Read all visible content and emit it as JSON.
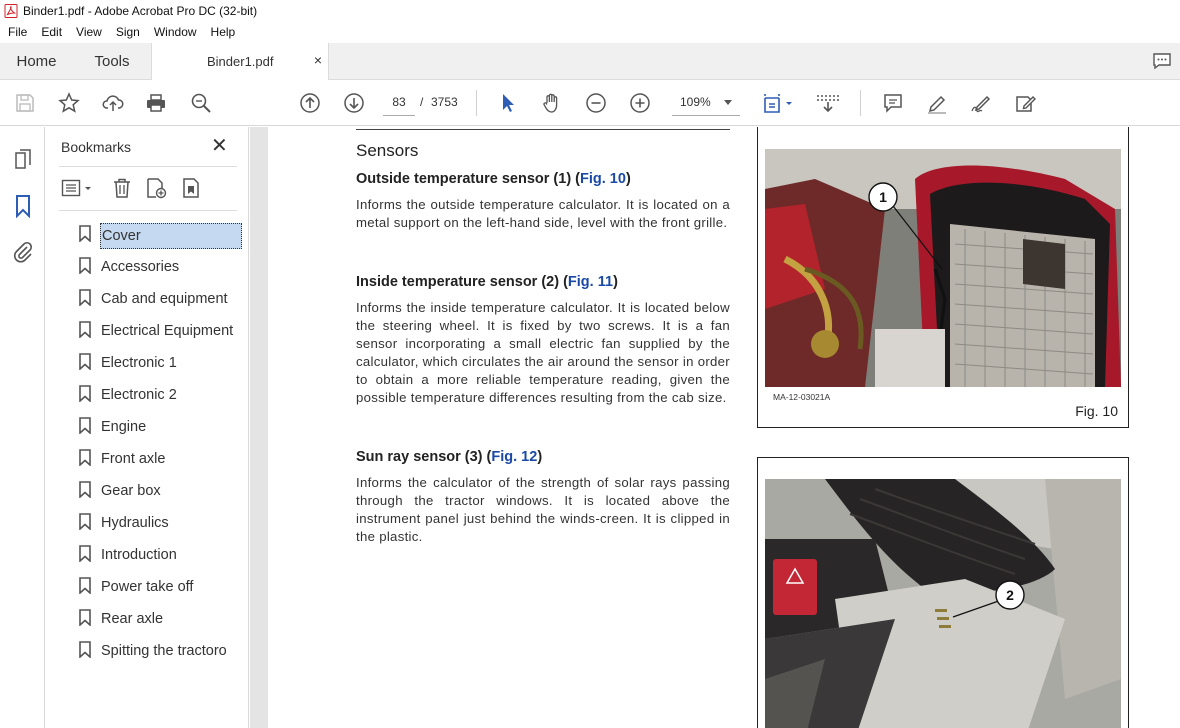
{
  "window": {
    "title": "Binder1.pdf - Adobe Acrobat Pro DC (32-bit)"
  },
  "menu": [
    "File",
    "Edit",
    "View",
    "Sign",
    "Window",
    "Help"
  ],
  "tabs": {
    "home": "Home",
    "tools": "Tools",
    "document": "Binder1.pdf",
    "close_glyph": "×"
  },
  "toolbar": {
    "current_page": "83",
    "page_separator": "/",
    "total_pages": "3753",
    "zoom": "109%"
  },
  "bookmarks": {
    "title": "Bookmarks",
    "close_glyph": "✕",
    "items": [
      {
        "label": "Cover",
        "selected": true
      },
      {
        "label": "Accessories"
      },
      {
        "label": "Cab and equipment"
      },
      {
        "label": "Electrical Equipment"
      },
      {
        "label": "Electronic 1"
      },
      {
        "label": "Electronic 2"
      },
      {
        "label": "Engine"
      },
      {
        "label": "Front axle"
      },
      {
        "label": "Gear box"
      },
      {
        "label": "Hydraulics"
      },
      {
        "label": "Introduction"
      },
      {
        "label": "Power take off"
      },
      {
        "label": "Rear axle"
      },
      {
        "label": "Spitting the tractoro"
      }
    ]
  },
  "document": {
    "section_title": "Sensors",
    "sections": [
      {
        "heading_prefix": "Outside temperature sensor (1) (",
        "fig_ref": "Fig. 10",
        "heading_suffix": ")",
        "body": "Informs the outside temperature calculator. It is located on a metal support on the left-hand side, level with the front grille."
      },
      {
        "heading_prefix": "Inside temperature sensor (2) (",
        "fig_ref": "Fig. 11",
        "heading_suffix": ")",
        "body": "Informs the inside temperature calculator. It is located below the steering wheel. It is fixed by two screws. It is a fan sensor incorporating a small electric fan supplied by the calculator, which circulates the air around the sensor in order to obtain a more reliable temperature reading, given the possible temperature differences resulting from the cab size."
      },
      {
        "heading_prefix": "Sun ray sensor (3) (",
        "fig_ref": "Fig. 12",
        "heading_suffix": ")",
        "body": "Informs the calculator of the strength of solar rays passing through the tractor windows. It is located above the instrument panel just behind the winds-creen. It is clipped in the plastic."
      }
    ],
    "figure1": {
      "callout": "1",
      "code": "MA-12-03021A",
      "caption": "Fig. 10"
    },
    "figure2": {
      "callout": "2"
    }
  },
  "colors": {
    "link": "#1a4aa6",
    "selection": "#c5d9f0",
    "acrobat_red": "#d4202a"
  }
}
